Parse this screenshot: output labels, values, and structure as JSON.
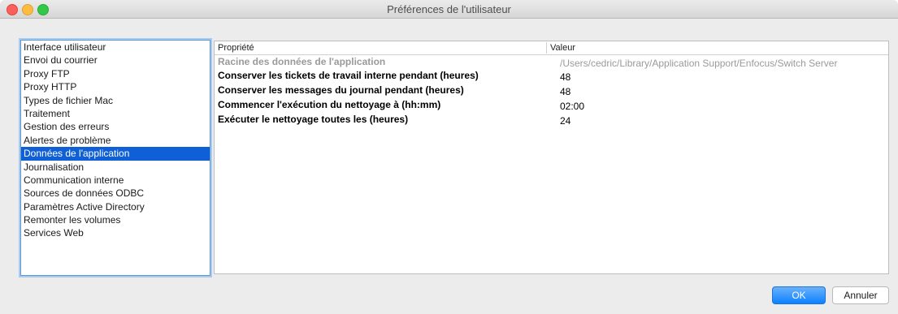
{
  "window": {
    "title": "Préférences de l'utilisateur"
  },
  "sidebar": {
    "items": [
      {
        "label": "Interface utilisateur"
      },
      {
        "label": "Envoi du courrier"
      },
      {
        "label": "Proxy FTP"
      },
      {
        "label": "Proxy HTTP"
      },
      {
        "label": "Types de fichier Mac"
      },
      {
        "label": "Traitement"
      },
      {
        "label": "Gestion des erreurs"
      },
      {
        "label": "Alertes de problème"
      },
      {
        "label": "Données de l'application",
        "selected": true
      },
      {
        "label": "Journalisation"
      },
      {
        "label": "Communication interne"
      },
      {
        "label": "Sources de données ODBC"
      },
      {
        "label": "Paramètres Active Directory"
      },
      {
        "label": "Remonter les volumes"
      },
      {
        "label": "Services Web"
      }
    ]
  },
  "table": {
    "headers": {
      "property": "Propriété",
      "value": "Valeur"
    },
    "rows": [
      {
        "property": "Racine des données de l'application",
        "value": "/Users/cedric/Library/Application Support/Enfocus/Switch Server",
        "disabled": true
      },
      {
        "property": "Conserver les tickets de travail interne pendant (heures)",
        "value": "48"
      },
      {
        "property": "Conserver les messages du journal pendant (heures)",
        "value": "48"
      },
      {
        "property": "Commencer l'exécution du nettoyage à (hh:mm)",
        "value": "02:00"
      },
      {
        "property": "Exécuter le nettoyage toutes les (heures)",
        "value": "24"
      }
    ]
  },
  "buttons": {
    "ok": "OK",
    "cancel": "Annuler"
  }
}
